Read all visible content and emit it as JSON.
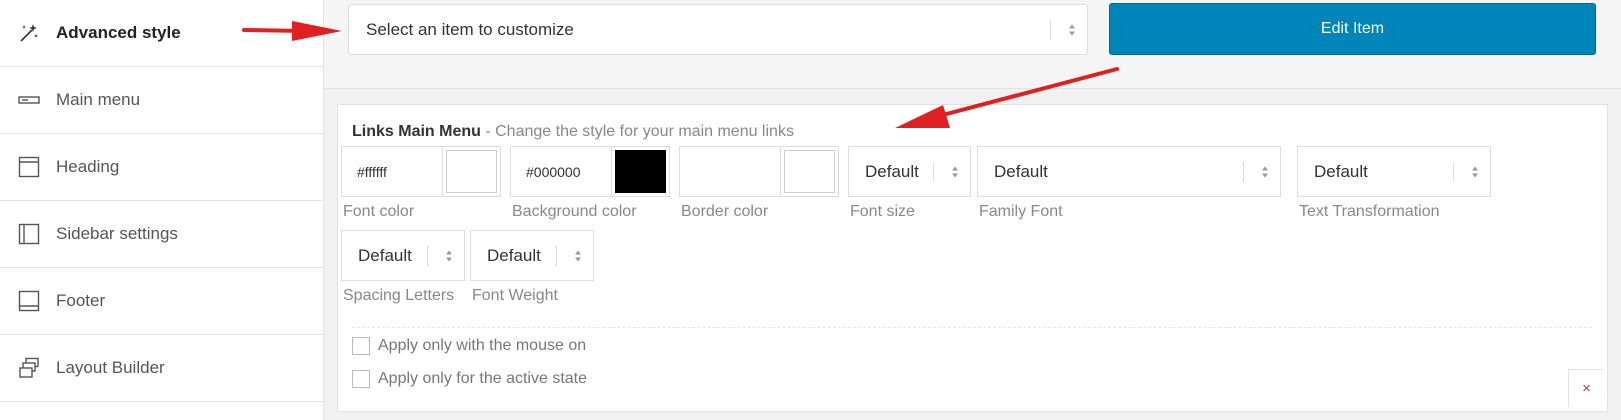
{
  "sidebar": {
    "items": [
      {
        "label": "Advanced style",
        "icon": "magic-wand-icon",
        "active": true
      },
      {
        "label": "Main menu",
        "icon": "menu-bar-icon"
      },
      {
        "label": "Heading",
        "icon": "heading-layout-icon"
      },
      {
        "label": "Sidebar settings",
        "icon": "sidebar-layout-icon"
      },
      {
        "label": "Footer",
        "icon": "footer-layout-icon"
      },
      {
        "label": "Layout Builder",
        "icon": "layout-builder-icon"
      }
    ]
  },
  "top": {
    "select_text": "Select an item to customize",
    "edit_button": "Edit Item"
  },
  "panel": {
    "title": "Links Main Menu",
    "description": " - Change the style for your main menu links",
    "font_color": {
      "value": "#ffffff",
      "label": "Font color",
      "swatch": "#ffffff"
    },
    "background_color": {
      "value": "#000000",
      "label": "Background color",
      "swatch": "#000000"
    },
    "border_color": {
      "value": "",
      "label": "Border color",
      "swatch": "#ffffff"
    },
    "font_size": {
      "value": "Default",
      "label": "Font size"
    },
    "family_font": {
      "value": "Default",
      "label": "Family Font"
    },
    "text_transformation": {
      "value": "Default",
      "label": "Text Transformation"
    },
    "spacing_letters": {
      "value": "Default",
      "label": "Spacing Letters"
    },
    "font_weight": {
      "value": "Default",
      "label": "Font Weight"
    },
    "checks": [
      {
        "label": "Apply only with the mouse on",
        "checked": false
      },
      {
        "label": "Apply only for the active state",
        "checked": false
      }
    ],
    "close_symbol": "×"
  },
  "colors": {
    "accent": "#0085ba",
    "arrow": "#e02020",
    "close": "#d63638"
  }
}
